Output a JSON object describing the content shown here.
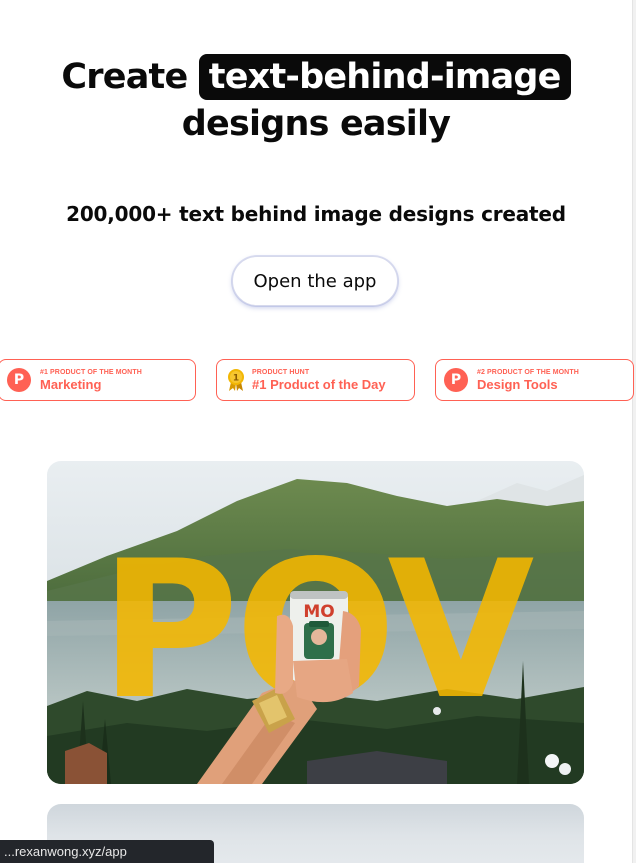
{
  "hero": {
    "title_before": "Create",
    "title_highlight": "text-behind-image",
    "title_after": "designs easily",
    "subtitle": "200,000+ text behind image designs created",
    "cta_label": "Open the app"
  },
  "badges": [
    {
      "caption": "#1 PRODUCT OF THE MONTH",
      "title": "Marketing",
      "icon": "product-hunt-icon"
    },
    {
      "caption": "PRODUCT HUNT",
      "title": "#1 Product of the Day",
      "icon": "gold-medal-icon",
      "medal_number": "1"
    },
    {
      "caption": "#2 PRODUCT OF THE MONTH",
      "title": "Design Tools",
      "icon": "product-hunt-icon"
    }
  ],
  "showcase": {
    "overlay_text": "POV",
    "can_text": "MO",
    "overlay_color": "#f5b800"
  },
  "colors": {
    "badge_accent": "#ff6154",
    "medal_gold": "#f2b705",
    "title_highlight_bg": "#0a0a0a"
  },
  "ph_letter": "P",
  "status_bar": {
    "url": "...rexanwong.xyz/app"
  }
}
